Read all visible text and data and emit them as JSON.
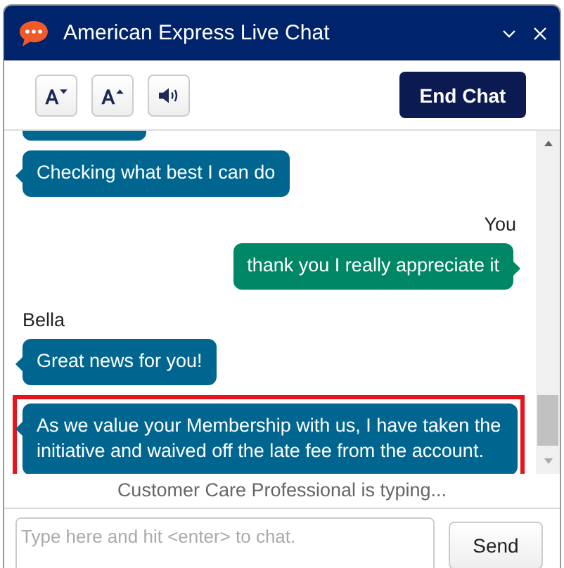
{
  "window": {
    "title": "American Express Live Chat"
  },
  "toolbar": {
    "end_button": "End Chat"
  },
  "messages": [
    {
      "kind": "agent",
      "highlighted": false
    },
    {
      "kind": "agent",
      "text": "Checking what best I can do",
      "highlighted": false
    },
    {
      "kind": "user",
      "sender": "You",
      "text": "thank you I really appreciate it",
      "highlighted": false
    },
    {
      "kind": "agent",
      "sender": "Bella",
      "text": "Great news for you!",
      "highlighted": false
    },
    {
      "kind": "agent",
      "text": "As we value your Membership with us, I have taken the initiative and waived off the late fee from the account.",
      "highlighted": true
    }
  ],
  "typing_status": "Customer Care Professional is typing...",
  "composer": {
    "placeholder": "Type here and hit <enter> to chat.",
    "send_button": "Send"
  }
}
